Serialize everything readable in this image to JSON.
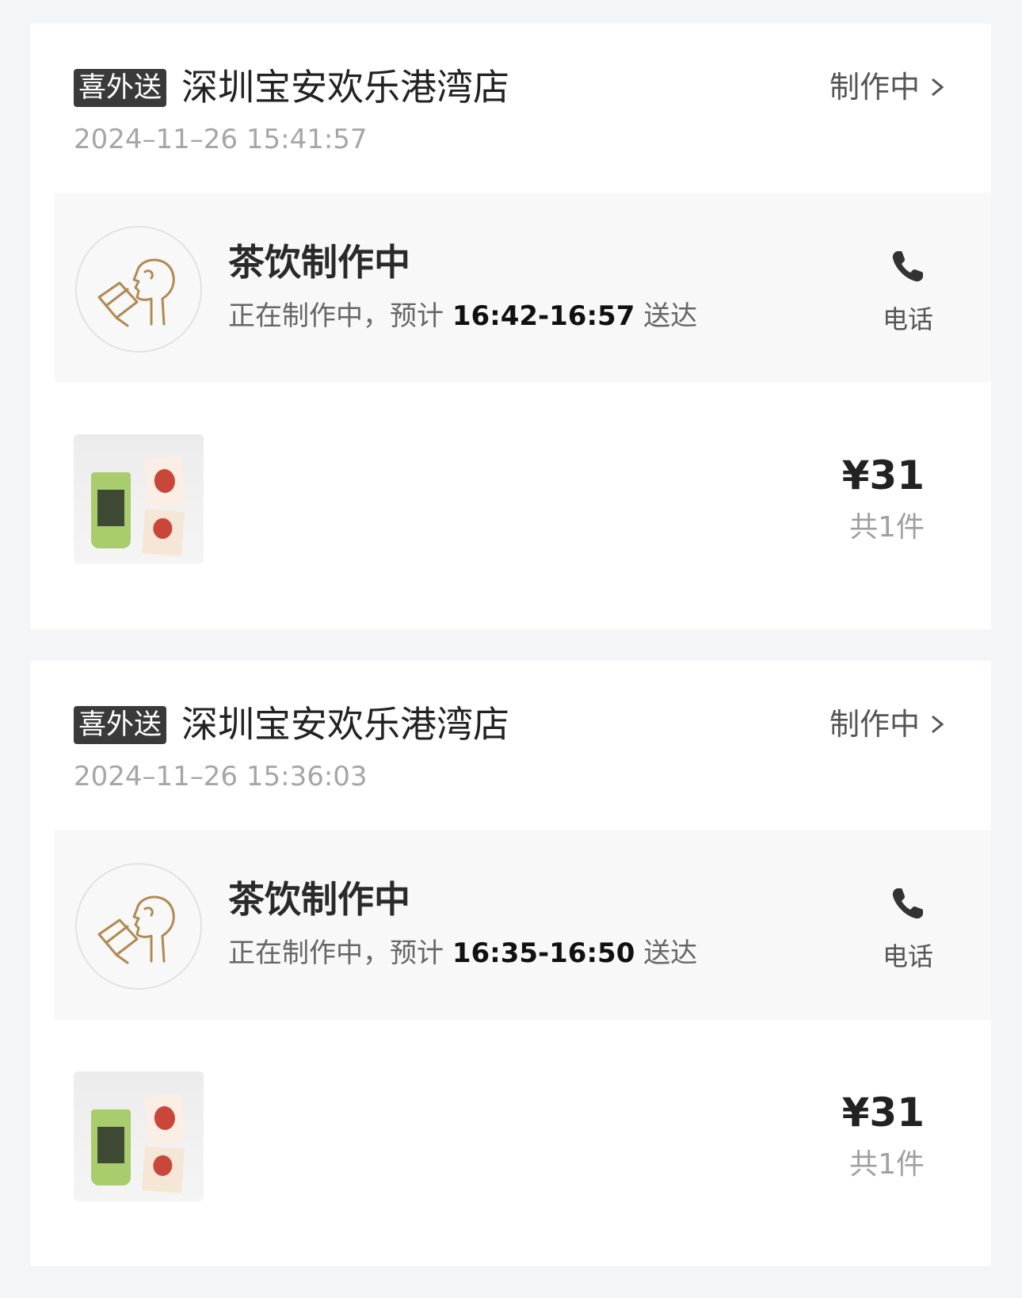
{
  "colors": {
    "page_bg": "#f4f5f7",
    "card_bg": "#ffffff",
    "panel_bg": "#f8f8f8",
    "badge_bg": "#3a3a3a",
    "accent_gold": "#b08a52"
  },
  "icons": {
    "avatar": "drinking-person-icon",
    "phone": "phone-icon",
    "chevron": "chevron-right-icon"
  },
  "orders": [
    {
      "brand_badge": "喜外送",
      "store_name": "深圳宝安欢乐港湾店",
      "status": "制作中",
      "time": "2024–11–26 15:41:57",
      "progress_title": "茶饮制作中",
      "progress_prefix": "正在制作中，预计",
      "progress_eta": "16:42-16:57",
      "progress_suffix": "送达",
      "phone_label": "电话",
      "price": "¥31",
      "count": "共1件"
    },
    {
      "brand_badge": "喜外送",
      "store_name": "深圳宝安欢乐港湾店",
      "status": "制作中",
      "time": "2024–11–26 15:36:03",
      "progress_title": "茶饮制作中",
      "progress_prefix": "正在制作中，预计",
      "progress_eta": "16:35-16:50",
      "progress_suffix": "送达",
      "phone_label": "电话",
      "price": "¥31",
      "count": "共1件"
    }
  ]
}
